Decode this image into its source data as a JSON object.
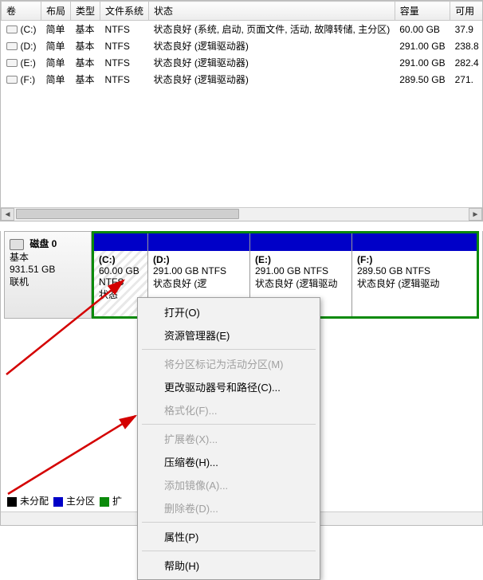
{
  "table": {
    "headers": [
      "卷",
      "布局",
      "类型",
      "文件系统",
      "状态",
      "容量",
      "可用"
    ],
    "rows": [
      {
        "drive": "(C:)",
        "layout": "简单",
        "type": "基本",
        "fs": "NTFS",
        "status": "状态良好 (系统, 启动, 页面文件, 活动, 故障转储, 主分区)",
        "cap": "60.00 GB",
        "free": "37.9"
      },
      {
        "drive": "(D:)",
        "layout": "简单",
        "type": "基本",
        "fs": "NTFS",
        "status": "状态良好 (逻辑驱动器)",
        "cap": "291.00 GB",
        "free": "238.8"
      },
      {
        "drive": "(E:)",
        "layout": "简单",
        "type": "基本",
        "fs": "NTFS",
        "status": "状态良好 (逻辑驱动器)",
        "cap": "291.00 GB",
        "free": "282.4"
      },
      {
        "drive": "(F:)",
        "layout": "简单",
        "type": "基本",
        "fs": "NTFS",
        "status": "状态良好 (逻辑驱动器)",
        "cap": "289.50 GB",
        "free": "271."
      }
    ]
  },
  "disk": {
    "label": "磁盘 0",
    "type": "基本",
    "size": "931.51 GB",
    "state": "联机",
    "parts": [
      {
        "letter": "(C:)",
        "line": "60.00 GB NTFS",
        "status": "状态"
      },
      {
        "letter": "(D:)",
        "line": "291.00 GB NTFS",
        "status": "状态良好 (逻"
      },
      {
        "letter": "(E:)",
        "line": "291.00 GB NTFS",
        "status": "状态良好 (逻辑驱动"
      },
      {
        "letter": "(F:)",
        "line": "289.50 GB NTFS",
        "status": "状态良好 (逻辑驱动"
      }
    ]
  },
  "legend": {
    "unalloc": "未分配",
    "primary": "主分区",
    "ext": "扩"
  },
  "ctx": {
    "open": "打开(O)",
    "explorer": "资源管理器(E)",
    "markactive": "将分区标记为活动分区(M)",
    "changeletter": "更改驱动器号和路径(C)...",
    "format": "格式化(F)...",
    "extend": "扩展卷(X)...",
    "shrink": "压缩卷(H)...",
    "addmirror": "添加镜像(A)...",
    "deletevol": "删除卷(D)...",
    "properties": "属性(P)",
    "help": "帮助(H)"
  }
}
